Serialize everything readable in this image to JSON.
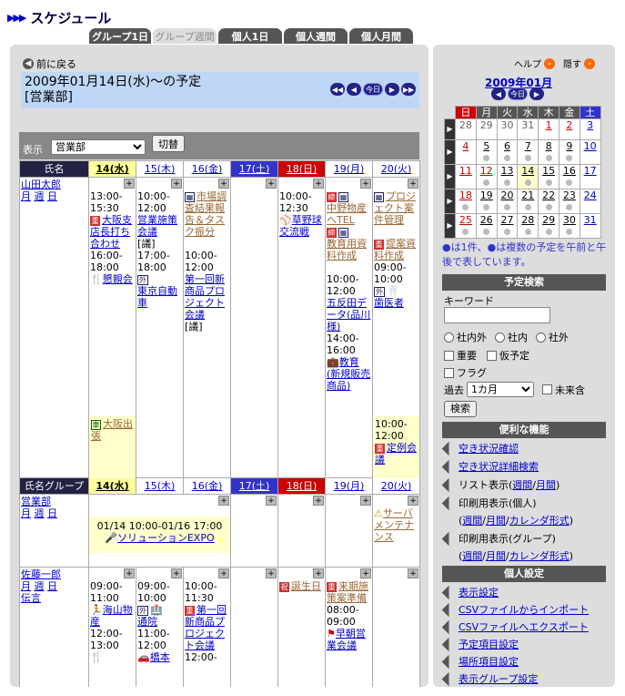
{
  "app_title": "スケジュール",
  "tabs": [
    "グループ1日",
    "グループ週間",
    "個人1日",
    "個人週間",
    "個人月間"
  ],
  "back": "前に戻る",
  "banner": {
    "line1": "2009年01月14日(水)〜の予定",
    "line2": "[営業部]"
  },
  "nav": {
    "today": "今日"
  },
  "select_label": "表示",
  "group_select": "営業部",
  "switch_btn": "切替",
  "header1": {
    "name": "氏名",
    "days": [
      "14(水)",
      "15(木)",
      "16(金)",
      "17(土)",
      "18(日)",
      "19(月)",
      "20(火)"
    ]
  },
  "header2": {
    "name": "氏名グループ",
    "days": [
      "14(水)",
      "15(木)",
      "16(金)",
      "17(土)",
      "18(日)",
      "19(月)",
      "20(火)"
    ]
  },
  "user1": {
    "name": "山田太郎",
    "links": [
      "月",
      "週",
      "日"
    ]
  },
  "u1d1": {
    "time1": "13:00-15:30",
    "ev1": "大阪支店長打ち合わせ",
    "time2": "16:00-18:00",
    "ev2": "懇親会",
    "ev3": "大阪出張"
  },
  "u1d2": {
    "time1": "10:00-12:00",
    "ev1": "営業施策会議",
    "tag": "[議]",
    "time2": "17:00-18:00",
    "ev2": "外",
    "ev2b": "東京自動車"
  },
  "u1d3": {
    "ev1": "市場調査結果報告＆タスク振分",
    "time2": "10:00-12:00",
    "ev2": "第一回新商品プロジェクト会議",
    "tag": "[議]"
  },
  "u1d5": {
    "time1": "10:00-12:30",
    "ev1": "草野球 交流戦"
  },
  "u1d6": {
    "ev1": "中野物産へTEL",
    "ev2": "教育用資料作成",
    "time3": "10:00-12:00",
    "ev3": "五反田データ(品川様)",
    "time4": "14:00-16:00",
    "ev4": "教育(新規販売商品)"
  },
  "u1d7": {
    "ev1": "プロジェクト案件管理",
    "ev2": "提案資料作成",
    "time3": "09:00-10:00",
    "ev3a": "外",
    "ev3": "歯医者",
    "time4": "10:00-12:00",
    "ev4": "定例会議"
  },
  "group": {
    "name": "営業部",
    "links": [
      "月",
      "週",
      "日"
    ],
    "span": "01/14 10:00-01/16 17:00",
    "span_ev": "ソリューションEXPO",
    "d7": "サーバメンテナンス"
  },
  "user2": {
    "name": "佐藤一郎",
    "links": [
      "月",
      "週",
      "日"
    ],
    "extra": "伝言"
  },
  "u2d1": {
    "time1": "09:00-11:00",
    "ev1": "海山物産",
    "time2": "12:00-13:00"
  },
  "u2d2": {
    "time1": "09:00-10:00",
    "ev1a": "外",
    "ev1": "通院",
    "time2": "11:00-12:00",
    "ev2": "橋本"
  },
  "u2d3": {
    "time1": "10:00-11:30",
    "ev1": "第一回新商品プロジェクト会議",
    "time2": "12:00-"
  },
  "u2d5": {
    "ev1": "誕生日"
  },
  "u2d6": {
    "ev1": "来期施策案準備",
    "time2": "08:00-09:00",
    "ev2": "早朝営業会議"
  },
  "side": {
    "help": "ヘルプ",
    "hide": "隠す",
    "month": "2009年01月",
    "today": "今日",
    "weekdays": [
      "日",
      "月",
      "火",
      "水",
      "木",
      "金",
      "土"
    ],
    "weeks": [
      [
        "28",
        "29",
        "30",
        "31",
        "1",
        "2",
        "3"
      ],
      [
        "4",
        "5",
        "6",
        "7",
        "8",
        "9",
        "10"
      ],
      [
        "11",
        "12",
        "13",
        "14",
        "15",
        "16",
        "17"
      ],
      [
        "18",
        "19",
        "20",
        "21",
        "22",
        "23",
        "24"
      ],
      [
        "25",
        "26",
        "27",
        "28",
        "29",
        "30",
        "31"
      ]
    ],
    "note": "●は1件、●は複数の予定を午前と午後で表しています。",
    "search_head": "予定検索",
    "keyword": "キーワード",
    "r1": "社内外",
    "r2": "社内",
    "r3": "社外",
    "c1": "重要",
    "c2": "仮予定",
    "c3": "フラグ",
    "past": "過去",
    "period": "1カ月",
    "future": "未来含",
    "search_btn": "検索",
    "tools_head": "便利な機能",
    "t1": "空き状況確認",
    "t2": "空き状況詳細検索",
    "t3": "リスト表示(",
    "t3a": "週間",
    "t3b": "月間",
    "t4": "印刷用表示(個人)",
    "t5a": "週間",
    "t5b": "月間",
    "t5c": "カレンダ形式",
    "t6": "印刷用表示(グループ)",
    "personal_head": "個人設定",
    "p1": "表示設定",
    "p2": "CSVファイルからインポート",
    "p3": "CSVファイルへエクスポート",
    "p4": "予定項目設定",
    "p5": "場所項目設定",
    "p6": "表示グループ設定"
  }
}
